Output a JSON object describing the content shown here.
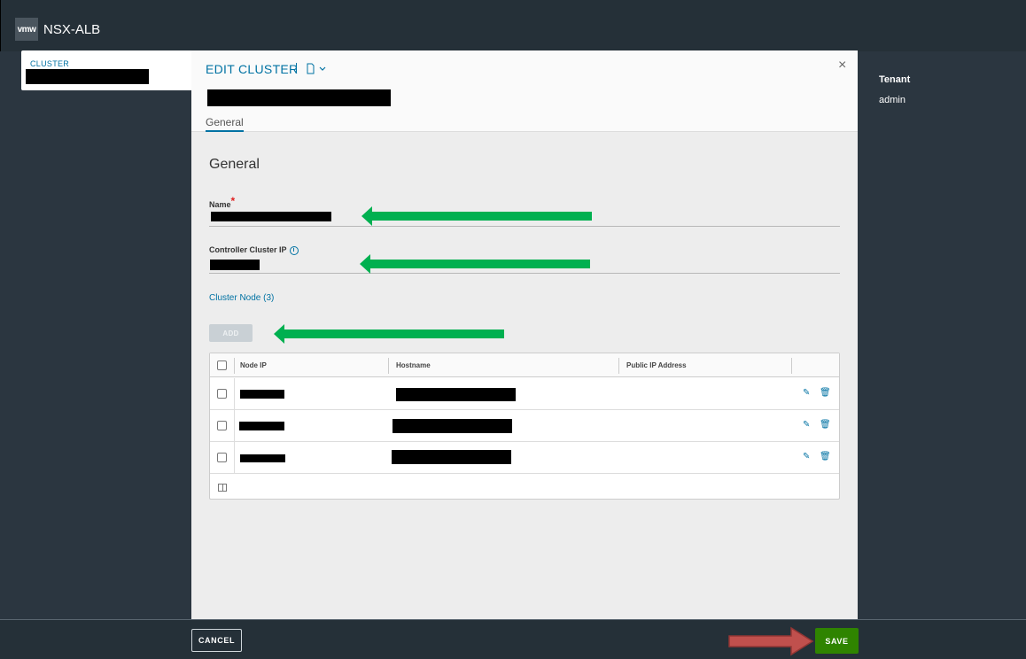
{
  "app": {
    "logo_text": "vmw",
    "title": "NSX-ALB"
  },
  "background_panel": {
    "label": "CLUSTER"
  },
  "tenant": {
    "label": "Tenant",
    "value": "admin"
  },
  "modal": {
    "title": "EDIT CLUSTER",
    "close_glyph": "×",
    "tab": "General",
    "section_title": "General",
    "name_field": {
      "label": "Name",
      "required_mark": "*"
    },
    "controller_ip_field": {
      "label": "Controller Cluster IP",
      "info_glyph": "i"
    },
    "cluster_node_label": "Cluster Node (3)",
    "add_button": "ADD",
    "table": {
      "columns": [
        "Node IP",
        "Hostname",
        "Public IP Address"
      ],
      "row_count": 3
    }
  },
  "footer": {
    "cancel_label": "CANCEL",
    "save_label": "SAVE"
  },
  "colors": {
    "background": "#2b3640",
    "accent_blue": "#0072a3",
    "save_green": "#2f8400",
    "annotation_green": "#00b050",
    "annotation_red": "#c0504d"
  },
  "icons": [
    "vmw-logo",
    "document-icon",
    "chevron-down-icon",
    "close-icon",
    "info-icon",
    "edit-icon",
    "trash-icon",
    "column-toggle-icon",
    "checkbox"
  ]
}
